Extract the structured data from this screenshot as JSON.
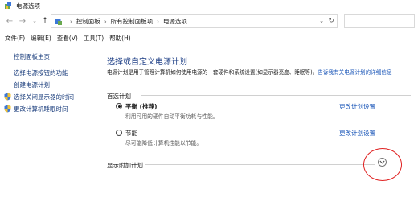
{
  "window": {
    "title": "电源选项"
  },
  "address": {
    "crumbs": [
      "控制面板",
      "所有控制面板项",
      "电源选项"
    ]
  },
  "menu": [
    "文件(F)",
    "编辑(E)",
    "查看(V)",
    "工具(T)",
    "帮助(H)"
  ],
  "sidebar": {
    "home": "控制面板主页",
    "items": [
      "选择电源按钮的功能",
      "创建电源计划",
      "选择关闭显示器的时间",
      "更改计算机睡眠时间"
    ]
  },
  "main": {
    "heading": "选择或自定义电源计划",
    "description": "电源计划是用于管理计算机如何使用电源的一套硬件和系统设置(如显示器亮度、睡眠等)。",
    "description_link": "告诉我有关电源计划的详细信息",
    "preferred_label": "首选计划",
    "plans": [
      {
        "name": "平衡 (推荐)",
        "desc": "利用可用的硬件自动平衡功耗与性能。",
        "settings": "更改计划设置",
        "selected": true
      },
      {
        "name": "节能",
        "desc": "尽可能降低计算机性能以节能。",
        "settings": "更改计划设置",
        "selected": false
      }
    ],
    "extra_label": "显示附加计划"
  }
}
